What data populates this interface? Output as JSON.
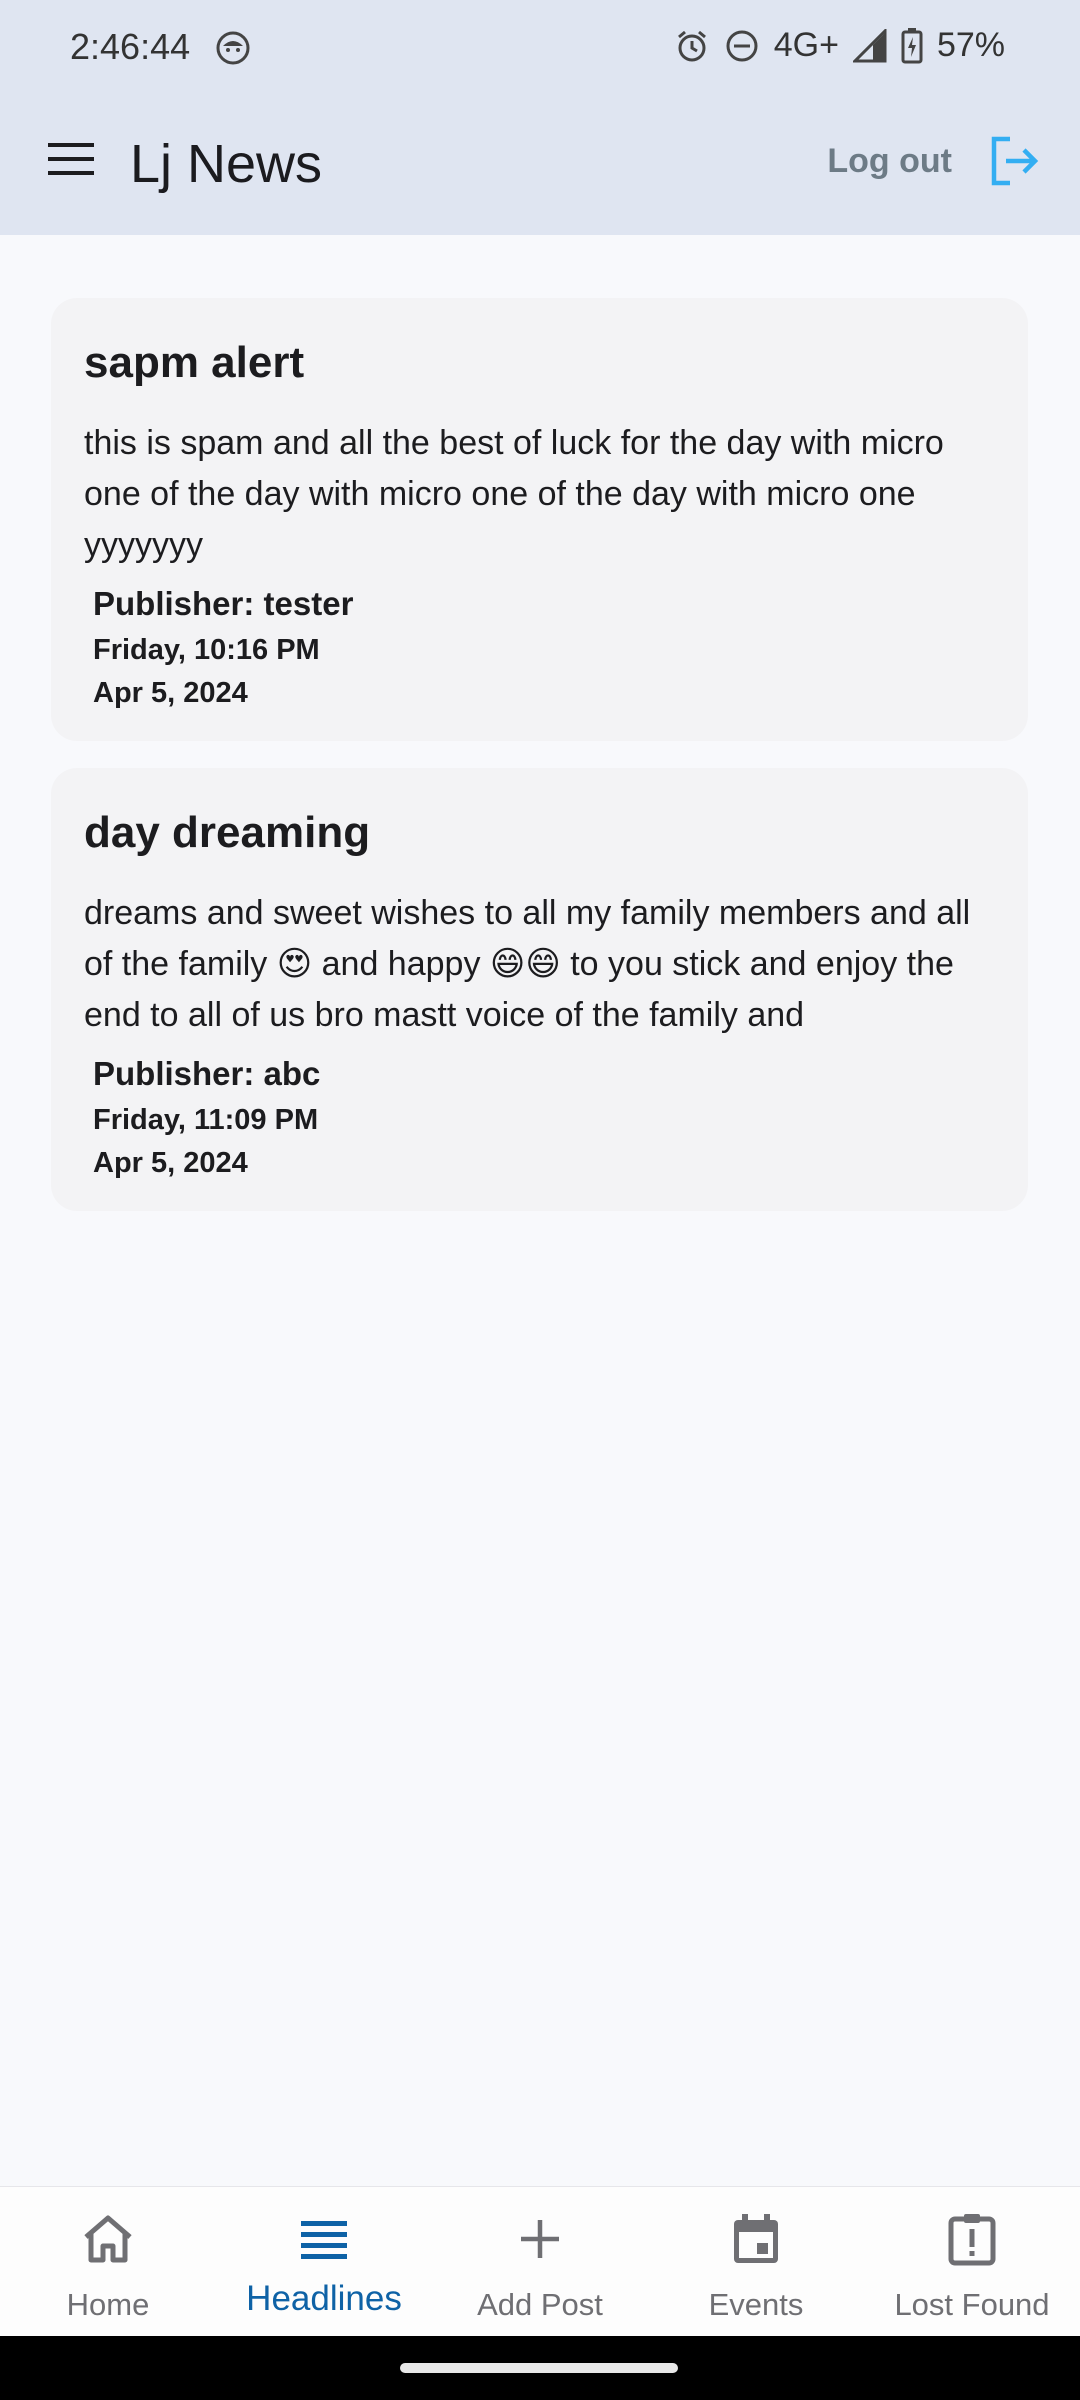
{
  "status_bar": {
    "time": "2:46:44",
    "network": "4G+",
    "battery": "57%"
  },
  "app_bar": {
    "title": "Lj News",
    "logout_label": "Log out"
  },
  "posts": [
    {
      "title": "sapm alert",
      "body": "this is spam and all the best of luck for the day with micro one of the day with micro one of the day with micro one yyyyyyy",
      "publisher": "Publisher: tester",
      "weekday_time": "Friday, 10:16 PM",
      "date": "Apr 5, 2024"
    },
    {
      "title": "day dreaming",
      "body": "dreams and sweet wishes to all my family members and all of the family 😍 and happy 😄😄 to you stick and enjoy the end to all of us bro mastt voice of the family and",
      "publisher": "Publisher: abc",
      "weekday_time": "Friday, 11:09 PM",
      "date": "Apr 5, 2024"
    }
  ],
  "bottom_nav": {
    "items": [
      {
        "label": "Home",
        "icon": "home-icon"
      },
      {
        "label": "Headlines",
        "icon": "headlines-icon",
        "active": true
      },
      {
        "label": "Add Post",
        "icon": "plus-icon"
      },
      {
        "label": "Events",
        "icon": "calendar-icon"
      },
      {
        "label": "Lost Found",
        "icon": "alert-clipboard-icon"
      }
    ]
  },
  "colors": {
    "app_bar_bg": "#dfe5f1",
    "page_bg": "#f8f9fc",
    "card_bg": "#f3f3f5",
    "accent_blue": "#0e62a6",
    "logout_icon": "#33aef2"
  }
}
